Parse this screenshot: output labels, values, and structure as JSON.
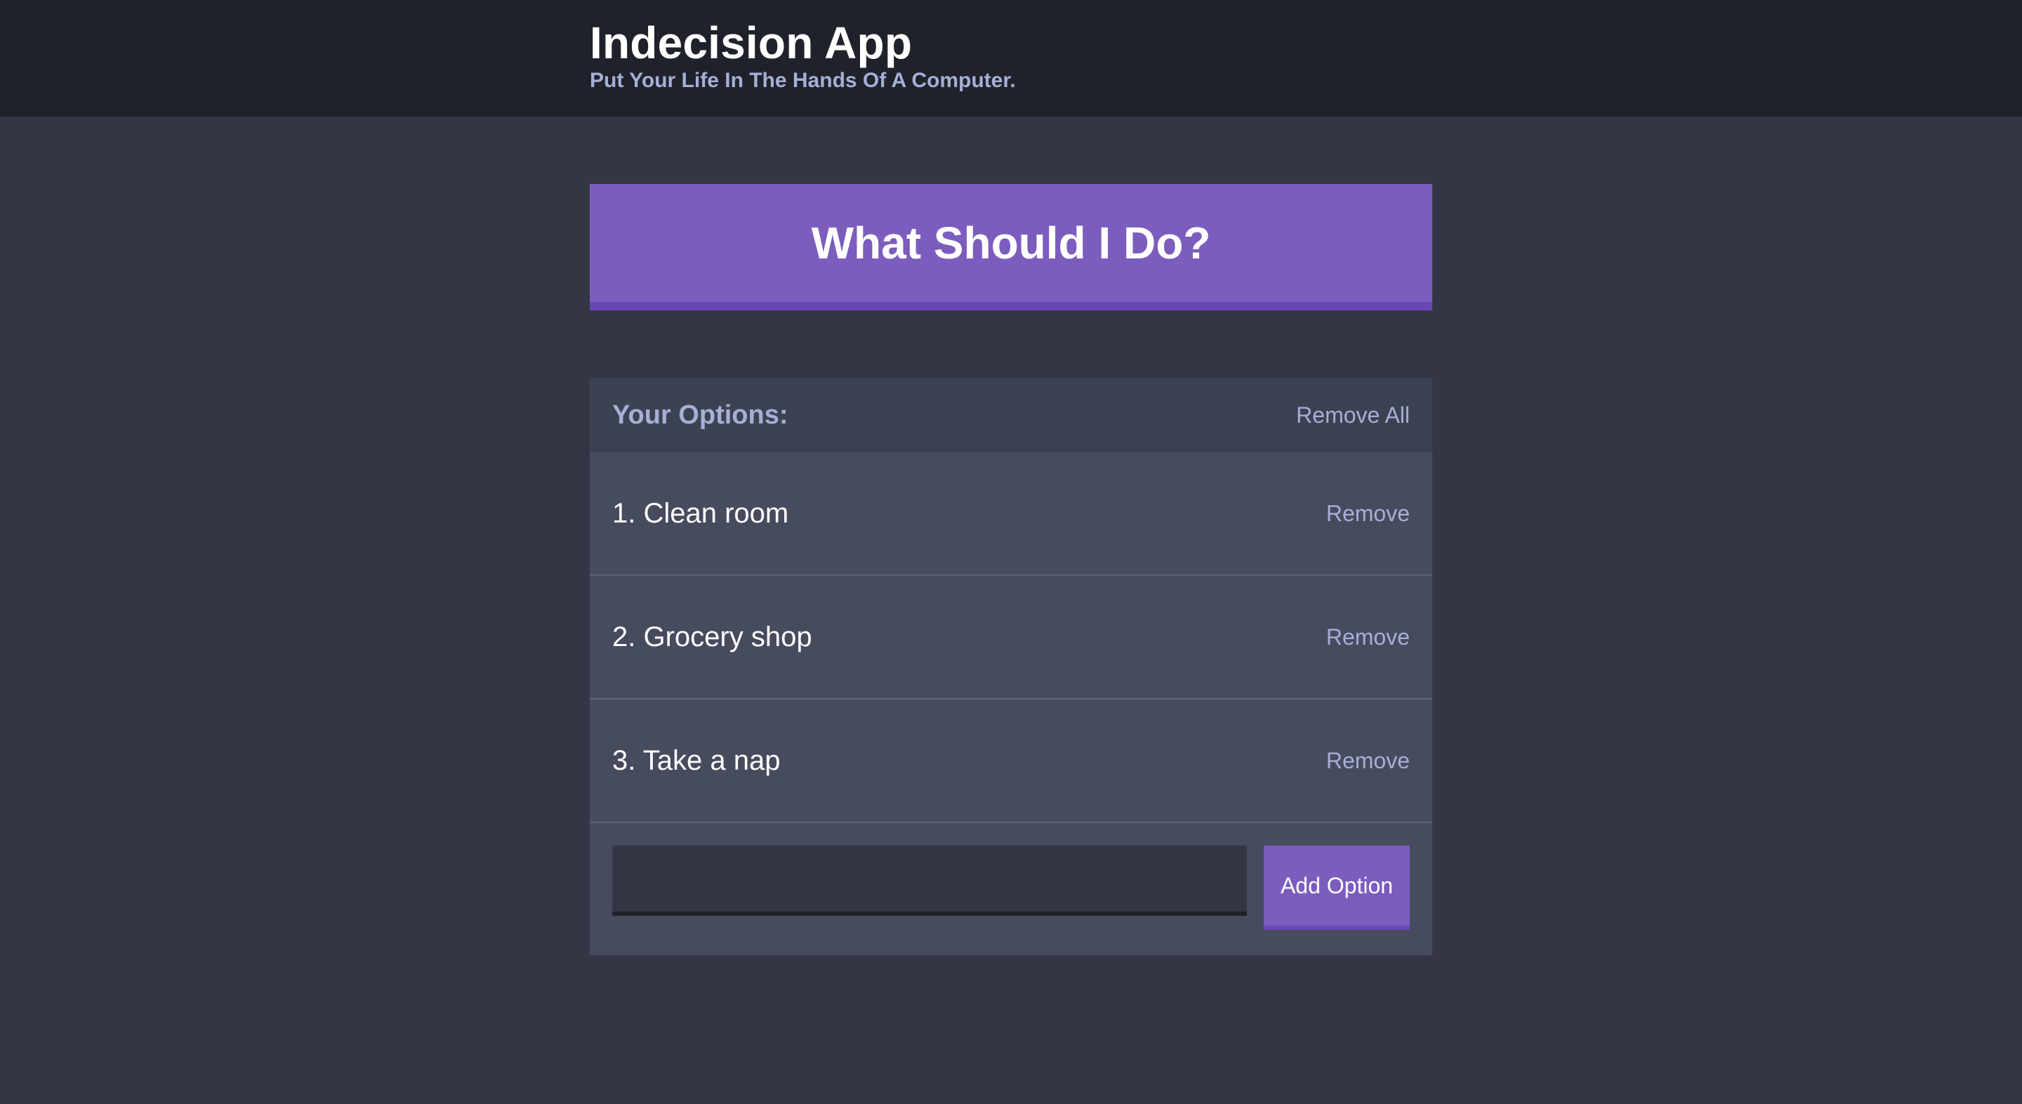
{
  "header": {
    "title": "Indecision App",
    "subtitle": "Put Your Life In The Hands Of A Computer."
  },
  "action": {
    "label": "What Should I Do?"
  },
  "widget": {
    "title": "Your Options:",
    "remove_all_label": "Remove All",
    "options": [
      {
        "text": "1. Clean room",
        "remove_label": "Remove"
      },
      {
        "text": "2. Grocery shop",
        "remove_label": "Remove"
      },
      {
        "text": "3. Take a nap",
        "remove_label": "Remove"
      }
    ],
    "input": {
      "value": "",
      "placeholder": ""
    },
    "add_label": "Add Option"
  },
  "colors": {
    "background": "#333745",
    "header_background": "#20222b",
    "accent": "#7c5dbd",
    "accent_dark": "#6a47b5",
    "widget_background": "#464b5e",
    "widget_header_background": "#3c4251",
    "muted_text": "#a5afd7"
  }
}
